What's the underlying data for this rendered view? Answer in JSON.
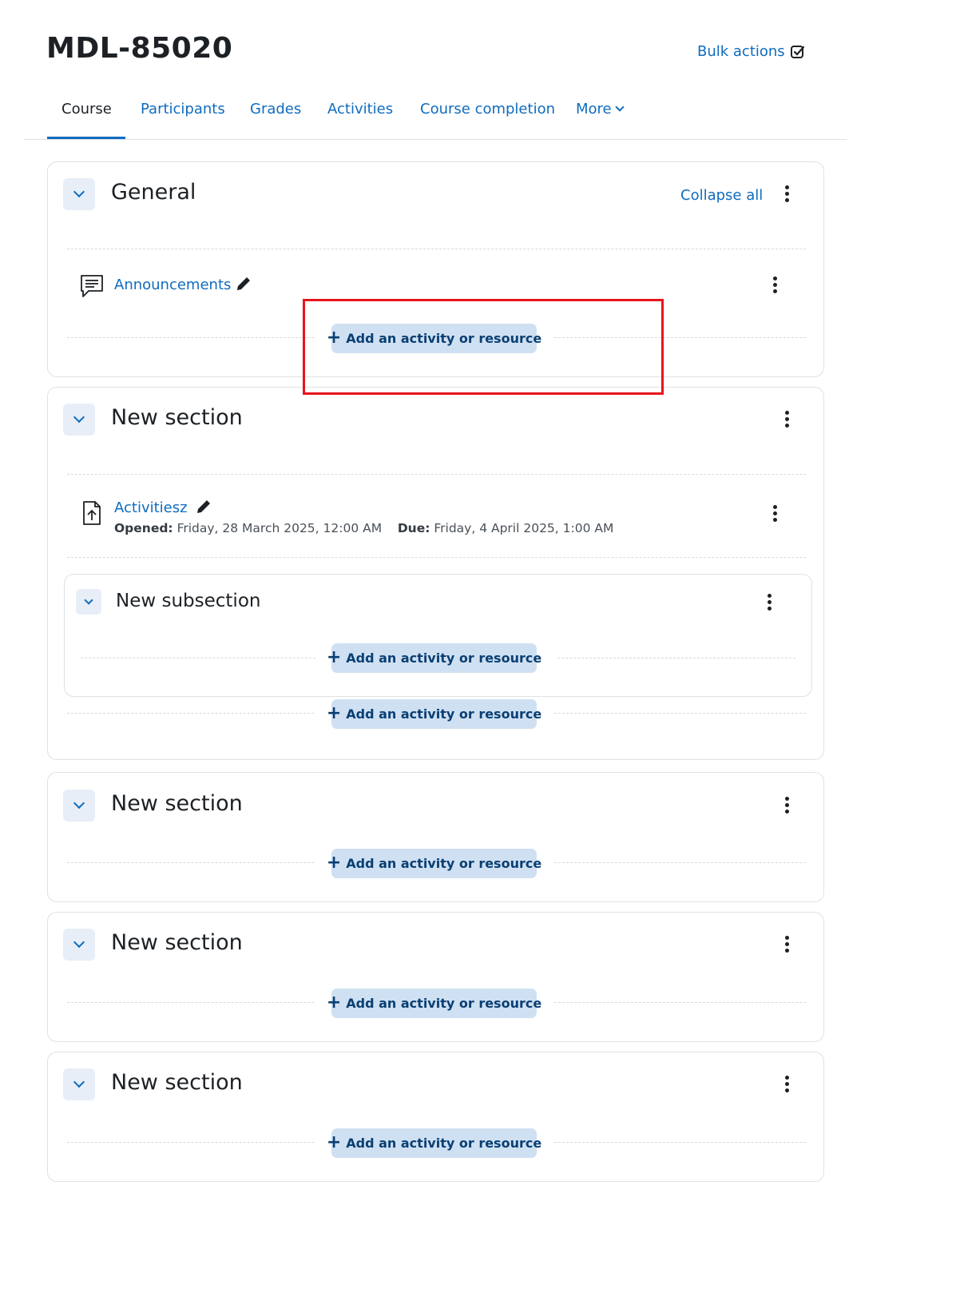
{
  "header": {
    "title": "MDL-85020",
    "bulk_actions_label": "Bulk actions"
  },
  "tabs": [
    {
      "label": "Course",
      "active": true
    },
    {
      "label": "Participants"
    },
    {
      "label": "Grades"
    },
    {
      "label": "Activities"
    },
    {
      "label": "Course completion"
    },
    {
      "label": "More"
    }
  ],
  "collapse_all_label": "Collapse all",
  "add_activity_label": "Add an activity or resource",
  "sections": [
    {
      "title": "General",
      "activities": [
        {
          "name": "Announcements",
          "icon": "forum-icon"
        }
      ]
    },
    {
      "title": "New section",
      "activities": [
        {
          "name": "Activitiesz",
          "icon": "assignment-icon",
          "opened_label": "Opened:",
          "opened_value": "Friday, 28 March 2025, 12:00 AM",
          "due_label": "Due:",
          "due_value": "Friday, 4 April 2025, 1:00 AM"
        }
      ],
      "subsection": {
        "title": "New subsection"
      }
    },
    {
      "title": "New section"
    },
    {
      "title": "New section"
    },
    {
      "title": "New section"
    }
  ],
  "colors": {
    "link": "#0f6cbf",
    "add_button_bg": "#cfe0f2",
    "highlight": "#e8141b"
  }
}
